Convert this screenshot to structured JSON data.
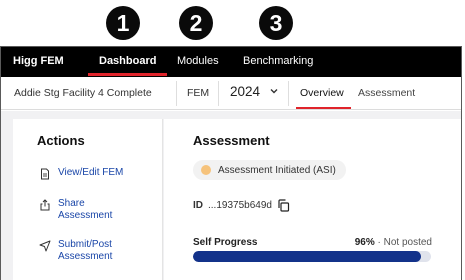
{
  "steps": [
    "1",
    "2",
    "3"
  ],
  "topnav": {
    "brand": "Higg FEM",
    "items": [
      {
        "label": "Dashboard",
        "active": true
      },
      {
        "label": "Modules",
        "active": false
      },
      {
        "label": "Benchmarking",
        "active": false
      }
    ]
  },
  "subbar": {
    "facility": "Addie Stg Facility 4 Complete",
    "module": "FEM",
    "year": "2024",
    "tabs": [
      {
        "label": "Overview",
        "active": true
      },
      {
        "label": "Assessment",
        "active": false
      }
    ]
  },
  "actions": {
    "title": "Actions",
    "items": [
      {
        "label_lines": [
          "View/Edit FEM"
        ],
        "icon": "document-icon"
      },
      {
        "label_lines": [
          "Share",
          "Assessment"
        ],
        "icon": "share-icon"
      },
      {
        "label_lines": [
          "Submit/Post",
          "Assessment"
        ],
        "icon": "send-icon"
      }
    ]
  },
  "assessment": {
    "title": "Assessment",
    "status": "Assessment Initiated (ASI)",
    "id_label": "ID",
    "id_value": "...19375b649d",
    "progress_label": "Self Progress",
    "progress_percent_text": "96%",
    "progress_separator": "·",
    "progress_status": "Not posted",
    "progress_value": 0.96
  },
  "colors": {
    "accent_red": "#e0242b",
    "nav_bg": "#000000",
    "link_blue": "#1a46a8",
    "progress_fill": "#13328a",
    "status_dot": "#f6c37c"
  }
}
